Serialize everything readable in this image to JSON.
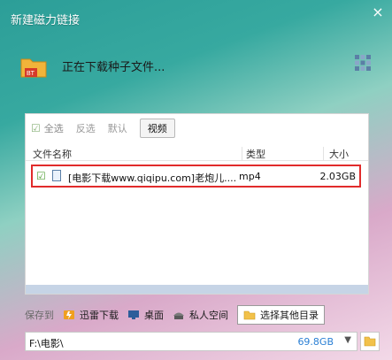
{
  "window": {
    "title": "新建磁力链接",
    "close_glyph": "×"
  },
  "status": {
    "icon": "bt-folder-icon",
    "bt_badge": "BT",
    "text": "正在下载种子文件...",
    "grid_icon": "grid-icon"
  },
  "filters": {
    "select_all_mark": "☑",
    "select_all": "全选",
    "invert": "反选",
    "default": "默认",
    "video": "视频"
  },
  "table": {
    "headers": {
      "name": "文件名称",
      "type": "类型",
      "size": "大小"
    },
    "rows": [
      {
        "checked_mark": "☑",
        "icon": "file-icon",
        "name": "[电影下载www.qiqipu.com]老炮儿....",
        "type": "mp4",
        "size": "2.03GB"
      }
    ]
  },
  "save": {
    "label": "保存到",
    "options": [
      {
        "label": "迅雷下载",
        "icon": "thunder-folder-icon",
        "color": "#f0a020"
      },
      {
        "label": "桌面",
        "icon": "desktop-icon",
        "color": "#2c5d9a"
      },
      {
        "label": "私人空间",
        "icon": "private-space-icon",
        "color": "#6a6a6a"
      },
      {
        "label": "选择其他目录",
        "icon": "folder-icon",
        "color": "#f2c14a",
        "selected": true
      }
    ]
  },
  "path": {
    "value": "F:\\电影\\",
    "free_space": "69.8GB",
    "dropdown_glyph": "▼",
    "browse_icon": "browse-folder-icon"
  },
  "colors": {
    "highlight_border": "#e12b2b",
    "free_space": "#2a7fd4"
  }
}
